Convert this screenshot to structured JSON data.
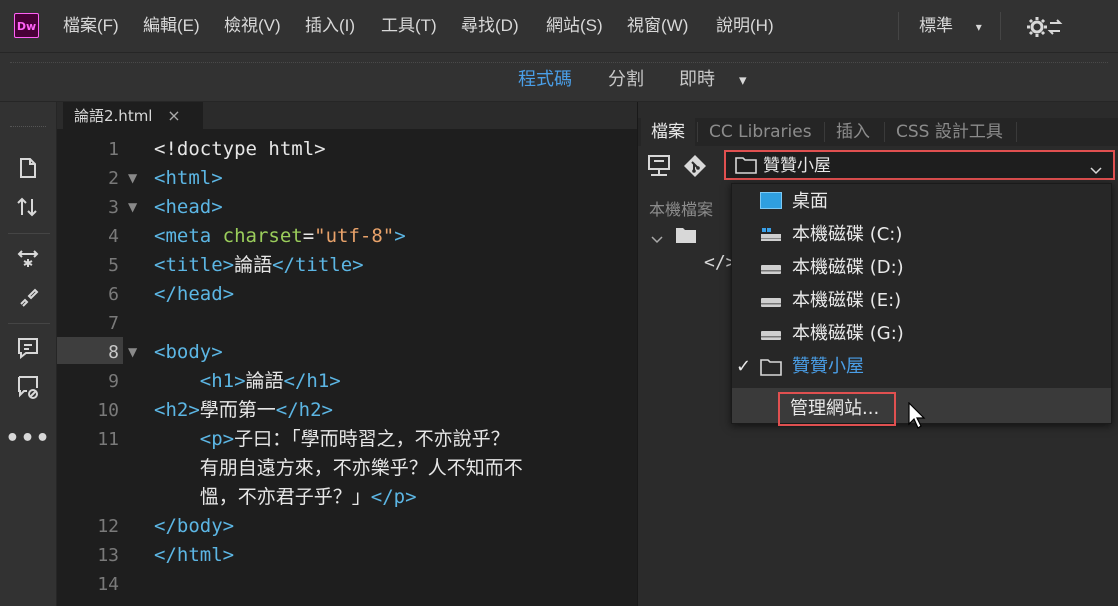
{
  "app": {
    "logo_text": "Dw",
    "brand_color": "#ff61f6"
  },
  "menu": {
    "items": [
      "檔案(F)",
      "編輯(E)",
      "檢視(V)",
      "插入(I)",
      "工具(T)",
      "尋找(D)",
      "網站(S)",
      "視窗(W)",
      "說明(H)"
    ],
    "workspace": "標準",
    "workspace_arrow": "▾",
    "sync_icon": "⚙⇆"
  },
  "view": {
    "tabs": [
      {
        "label": "程式碼",
        "active": true
      },
      {
        "label": "分割",
        "active": false
      },
      {
        "label": "即時",
        "active": false
      }
    ],
    "dropdown_arrow": "▾"
  },
  "editor": {
    "file_tab": "論語2.html",
    "close_glyph": "×",
    "current_line": 8,
    "lines": [
      {
        "n": "1",
        "fold": "",
        "parts": [
          [
            "",
            "<!doctype html>"
          ]
        ]
      },
      {
        "n": "2",
        "fold": "▼",
        "parts": [
          [
            "tag",
            "<html>"
          ]
        ]
      },
      {
        "n": "3",
        "fold": "▼",
        "parts": [
          [
            "tag",
            "<head>"
          ]
        ]
      },
      {
        "n": "4",
        "fold": "",
        "parts": [
          [
            "tag",
            "<meta "
          ],
          [
            "attr",
            "charset"
          ],
          [
            "",
            "="
          ],
          [
            "str",
            "\"utf-8\""
          ],
          [
            "tag",
            ">"
          ]
        ]
      },
      {
        "n": "5",
        "fold": "",
        "parts": [
          [
            "tag",
            "<title>"
          ],
          [
            "cjk",
            "論語"
          ],
          [
            "tag",
            "</title>"
          ]
        ]
      },
      {
        "n": "6",
        "fold": "",
        "parts": [
          [
            "tag",
            "</head>"
          ]
        ]
      },
      {
        "n": "7",
        "fold": "",
        "parts": []
      },
      {
        "n": "8",
        "fold": "▼",
        "parts": [
          [
            "tag",
            "<body>"
          ]
        ]
      },
      {
        "n": "9",
        "fold": "",
        "parts": [
          [
            "",
            "    "
          ],
          [
            "tag",
            "<h1>"
          ],
          [
            "cjk",
            "論語"
          ],
          [
            "tag",
            "</h1>"
          ]
        ]
      },
      {
        "n": "10",
        "fold": "",
        "parts": [
          [
            "tag",
            "<h2>"
          ],
          [
            "cjk",
            "學而第一"
          ],
          [
            "tag",
            "</h2>"
          ]
        ]
      },
      {
        "n": "11",
        "fold": "",
        "parts": [
          [
            "",
            "    "
          ],
          [
            "tag",
            "<p>"
          ],
          [
            "cjk",
            "子曰：「學而時習之，不亦說乎？"
          ]
        ]
      },
      {
        "n": "",
        "fold": "",
        "parts": [
          [
            "",
            "    "
          ],
          [
            "cjk",
            "有朋自遠方來，不亦樂乎？人不知而不"
          ]
        ]
      },
      {
        "n": "",
        "fold": "",
        "parts": [
          [
            "",
            "    "
          ],
          [
            "cjk",
            "慍，不亦君子乎？」"
          ],
          [
            "tag",
            "</p>"
          ]
        ]
      },
      {
        "n": "12",
        "fold": "",
        "parts": [
          [
            "tag",
            "</body>"
          ]
        ]
      },
      {
        "n": "13",
        "fold": "",
        "parts": [
          [
            "tag",
            "</html>"
          ]
        ]
      },
      {
        "n": "14",
        "fold": "",
        "parts": []
      }
    ]
  },
  "panel": {
    "tabs": [
      "檔案",
      "CC Libraries",
      "插入",
      "CSS 設計工具"
    ],
    "active_tab": 0,
    "site_select_value": "贊贊小屋",
    "local_files_label": "本機檔案",
    "code_icon": "</>",
    "dropdown": {
      "items": [
        {
          "label": "桌面",
          "icon": "desktop"
        },
        {
          "label": "本機磁碟 (C:)",
          "icon": "drive-c"
        },
        {
          "label": "本機磁碟 (D:)",
          "icon": "drive"
        },
        {
          "label": "本機磁碟 (E:)",
          "icon": "drive"
        },
        {
          "label": "本機磁碟 (G:)",
          "icon": "drive"
        },
        {
          "label": "贊贊小屋",
          "icon": "folder",
          "checked": true
        }
      ],
      "manage_label": "管理網站...",
      "check_glyph": "✓",
      "selected_color": "#4a9fe8"
    }
  }
}
